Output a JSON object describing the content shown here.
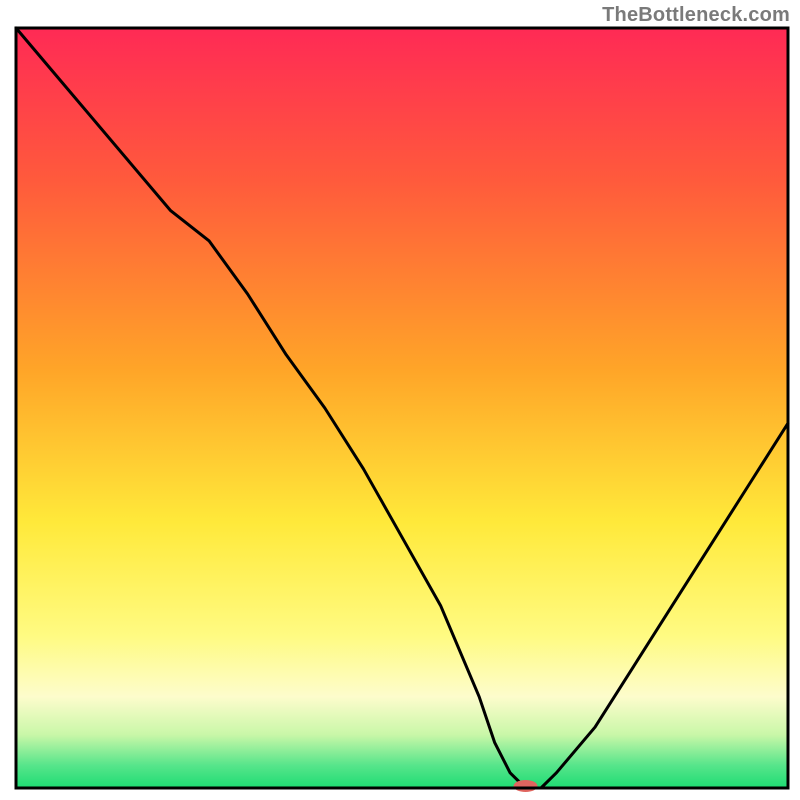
{
  "watermark": "TheBottleneck.com",
  "chart_data": {
    "type": "line",
    "title": "",
    "xlabel": "",
    "ylabel": "",
    "xlim": [
      0,
      100
    ],
    "ylim": [
      0,
      100
    ],
    "grid": false,
    "legend": false,
    "background_gradient": [
      {
        "y_pct": 0,
        "color": "#ff2a55"
      },
      {
        "y_pct": 20,
        "color": "#ff5a3c"
      },
      {
        "y_pct": 45,
        "color": "#ffa528"
      },
      {
        "y_pct": 65,
        "color": "#ffe93a"
      },
      {
        "y_pct": 80,
        "color": "#fffb82"
      },
      {
        "y_pct": 88,
        "color": "#fdfccc"
      },
      {
        "y_pct": 93,
        "color": "#c9f7a8"
      },
      {
        "y_pct": 97,
        "color": "#57e58b"
      },
      {
        "y_pct": 100,
        "color": "#1edc73"
      }
    ],
    "series": [
      {
        "name": "bottleneck-curve",
        "x": [
          0,
          5,
          10,
          15,
          20,
          25,
          30,
          35,
          40,
          45,
          50,
          55,
          60,
          62,
          64,
          66,
          68,
          70,
          75,
          80,
          85,
          90,
          95,
          100
        ],
        "y": [
          100,
          94,
          88,
          82,
          76,
          72,
          65,
          57,
          50,
          42,
          33,
          24,
          12,
          6,
          2,
          0,
          0,
          2,
          8,
          16,
          24,
          32,
          40,
          48
        ]
      }
    ],
    "marker": {
      "x": 66,
      "y": 0,
      "color": "#e0655f",
      "rx": 12,
      "ry": 6
    },
    "frame_color": "#000000"
  }
}
